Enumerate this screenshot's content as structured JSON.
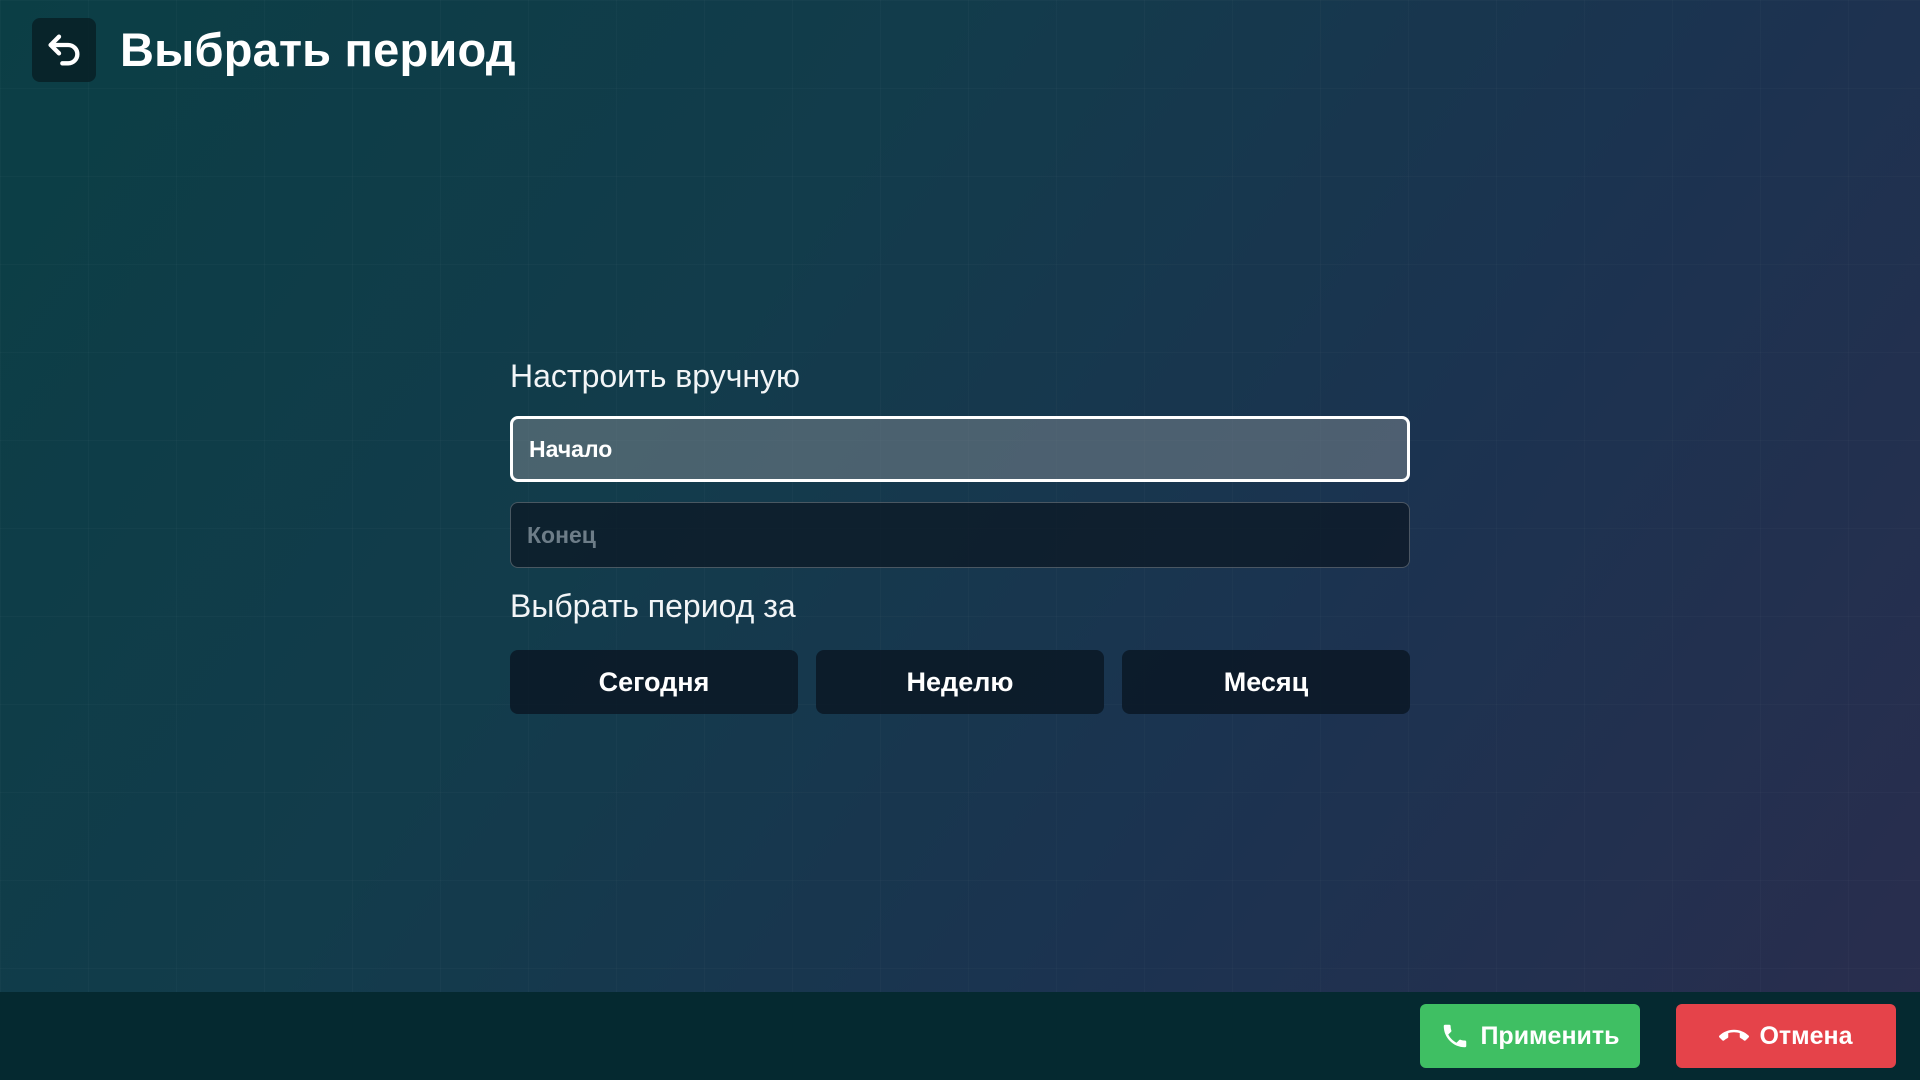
{
  "header": {
    "title": "Выбрать период",
    "back_icon": "undo-arrow-icon"
  },
  "manual": {
    "label": "Настроить вручную",
    "start_label": "Начало",
    "end_label": "Конец"
  },
  "preset": {
    "label": "Выбрать период за",
    "options": [
      "Сегодня",
      "Неделю",
      "Месяц"
    ]
  },
  "footer": {
    "apply_label": "Применить",
    "apply_icon": "phone-icon",
    "cancel_label": "Отмена",
    "cancel_icon": "hang-up-icon"
  },
  "colors": {
    "apply": "#3fbf63",
    "cancel": "#e5434a",
    "footer_bg": "#052930"
  }
}
